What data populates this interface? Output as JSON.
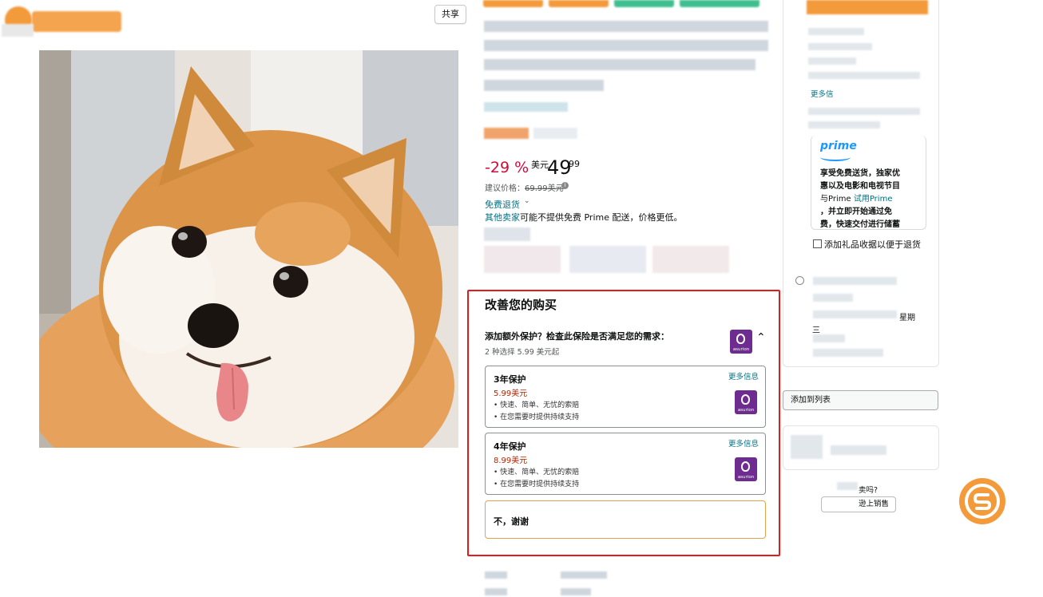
{
  "header": {
    "share_label": "共享"
  },
  "product": {
    "discount": "-29 %",
    "currency": "美元",
    "price_whole": "49",
    "price_fraction": "99",
    "list_price_label": "建议价格：",
    "list_price_value": "69.99美元",
    "free_returns": "免费退货",
    "seller_note_link": "其他卖家",
    "seller_note_text": "可能不提供免费 Prime 配送，价格更低。"
  },
  "protection": {
    "title": "改善您的购买",
    "question": "添加额外保护？检查此保险是否满足您的需求：",
    "from_price": "2 种选择 5.99 美元起",
    "badge_text": "asurion",
    "plans": [
      {
        "title": "3年保护",
        "price": "5.99美元",
        "feature1": "•  快速、简单、无忧的索赔",
        "feature2": "•  在您需要时提供持续支持",
        "more": "更多信息"
      },
      {
        "title": "4年保护",
        "price": "8.99美元",
        "feature1": "•  快速、简单、无忧的索赔",
        "feature2": "•  在您需要时提供持续支持",
        "more": "更多信息"
      }
    ],
    "decline": "不，谢谢"
  },
  "sidebar": {
    "more_link": "更多信",
    "prime_word": "prime",
    "prime_line1": "享受免费送货，独家优",
    "prime_line2": "惠以及电影和电视节目",
    "prime_line3_a": "与Prime ",
    "prime_line3_b": "试用Prime",
    "prime_line4": "，并立即开始通过免",
    "prime_line5": "费，快速交付进行储蓄",
    "gift_receipt": "添加礼品收据以便于退货",
    "week_label": "星期",
    "three_label": "三",
    "add_to_list": "添加到列表",
    "sell_question": "卖吗?",
    "sell_button": "逊上销售"
  },
  "colors": {
    "accent_orange": "#f39a3b",
    "price_red": "#cc0c39",
    "link_teal": "#007185",
    "highlight_red": "#e31b1b",
    "asurion_purple": "#6e2c91",
    "prime_blue": "#1a98ff"
  }
}
